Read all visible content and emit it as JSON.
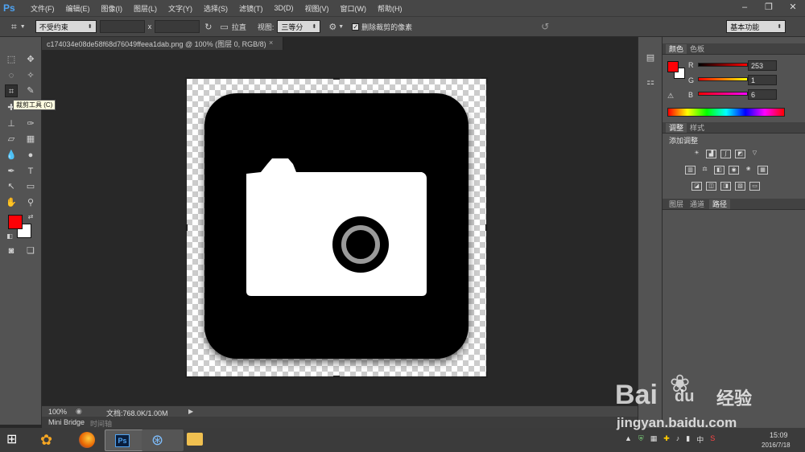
{
  "app": {
    "logo": "Ps"
  },
  "menu": [
    "文件(F)",
    "编辑(E)",
    "图像(I)",
    "图层(L)",
    "文字(Y)",
    "选择(S)",
    "滤镜(T)",
    "3D(D)",
    "视图(V)",
    "窗口(W)",
    "帮助(H)"
  ],
  "options": {
    "ratio": "不受约束",
    "x_label": "x",
    "straighten": "拉直",
    "view_label": "视图:",
    "view_value": "三等分",
    "delete_cropped": "删除裁剪的像素",
    "workspace": "基本功能"
  },
  "document": {
    "tab_title": "c174034e08de58f68d76049ffeea1dab.png @ 100% (图层 0, RGB/8)"
  },
  "tooltip": "裁剪工具 (C)",
  "status": {
    "zoom": "100%",
    "doc_info": "文档:768.0K/1.00M"
  },
  "bottom_tabs": [
    "Mini Bridge",
    "时间轴"
  ],
  "color_panel": {
    "tabs": [
      "颜色",
      "色板"
    ],
    "r_label": "R",
    "g_label": "G",
    "b_label": "B",
    "r": "253",
    "g": "1",
    "b": "6",
    "fg_color": "#fd0106",
    "bg_color": "#ffffff"
  },
  "adjust_panel": {
    "tabs": [
      "调整",
      "样式"
    ],
    "heading": "添加调整"
  },
  "layers_panel": {
    "tabs": [
      "图层",
      "通道",
      "路径"
    ]
  },
  "taskbar": {
    "time": "15:09",
    "date": "2016/7/18",
    "ime": "中"
  },
  "watermark": {
    "brand": "Bai",
    "brand2": "du",
    "jingyan": "经验",
    "url": "jingyan.baidu.com"
  }
}
